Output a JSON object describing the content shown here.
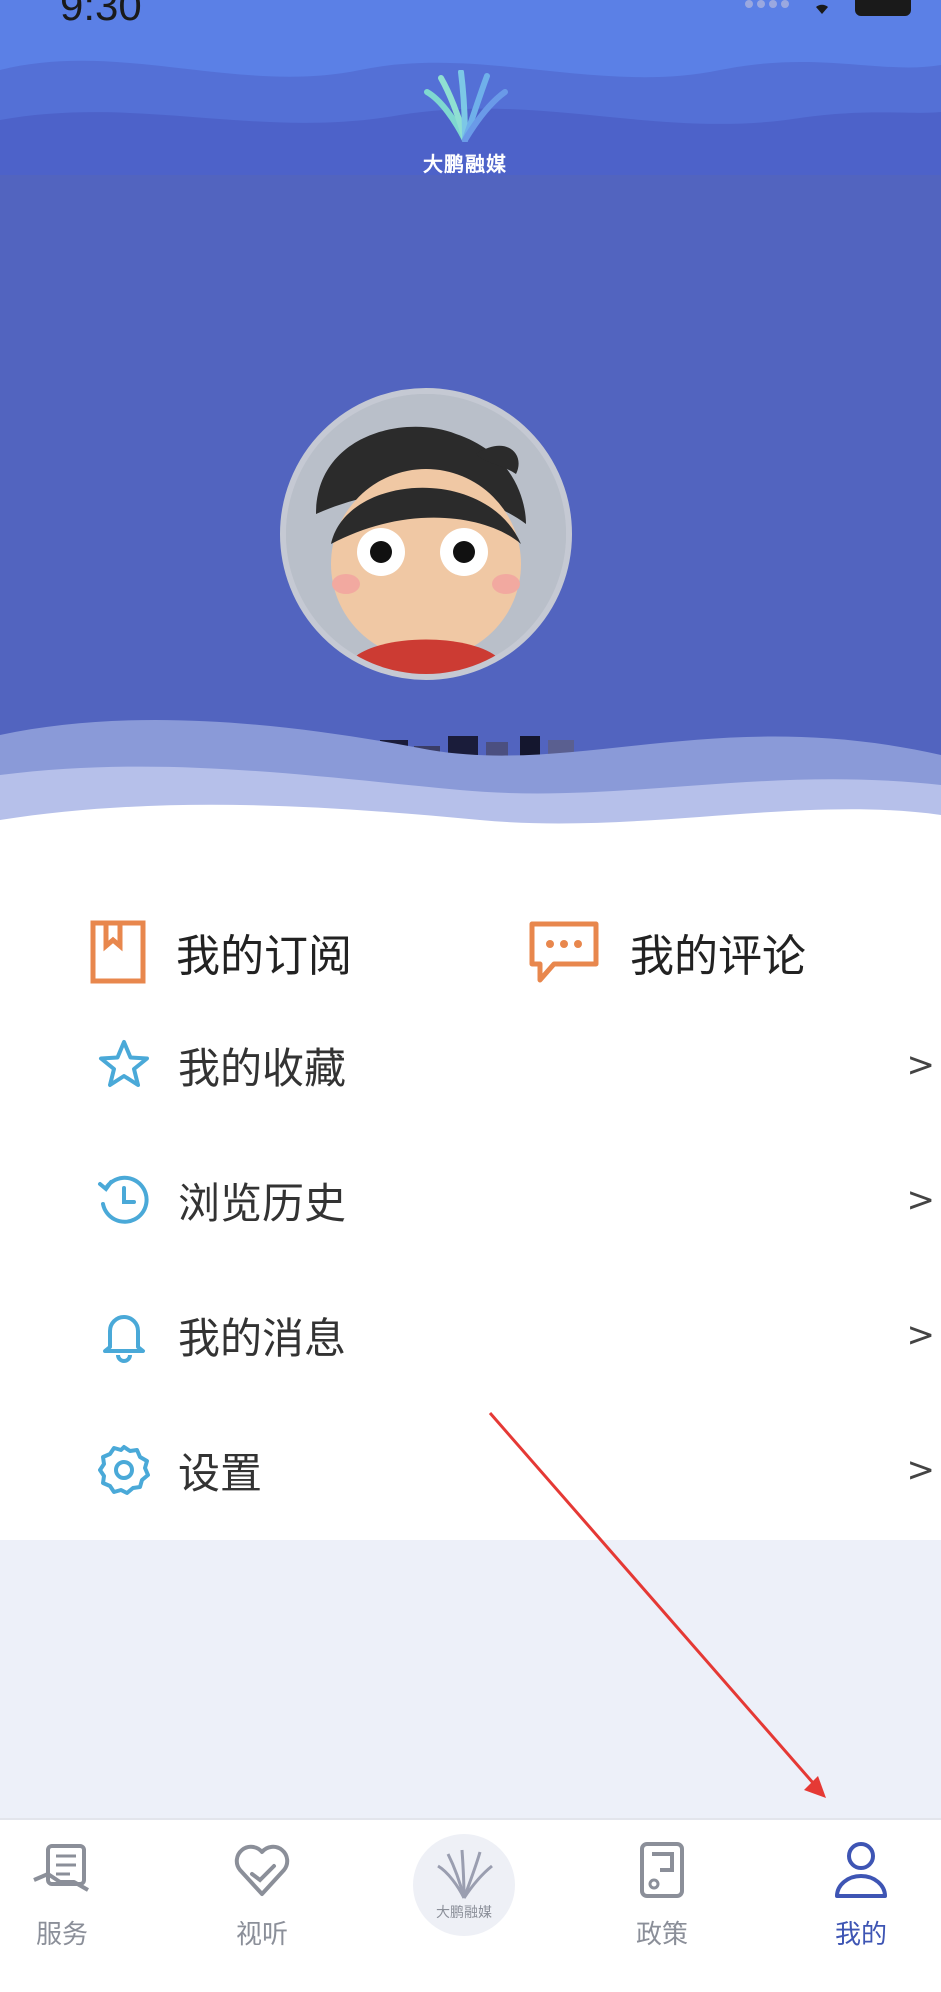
{
  "status_bar": {
    "time": "9:30"
  },
  "header": {
    "logo_text": "大鹏融媒"
  },
  "quick_links": [
    {
      "label": "我的订阅",
      "icon": "bookmark-book-icon"
    },
    {
      "label": "我的评论",
      "icon": "comment-bubble-icon"
    }
  ],
  "menu": [
    {
      "label": "我的收藏",
      "icon": "star-icon",
      "arrow": ">"
    },
    {
      "label": "浏览历史",
      "icon": "history-clock-icon",
      "arrow": ">"
    },
    {
      "label": "我的消息",
      "icon": "bell-icon",
      "arrow": ">"
    },
    {
      "label": "设置",
      "icon": "gear-icon",
      "arrow": ">"
    }
  ],
  "tabbar": {
    "tabs": [
      {
        "label": "服务",
        "icon": "service-icon",
        "active": false
      },
      {
        "label": "视听",
        "icon": "heart-icon",
        "active": false
      },
      {
        "label": "政策",
        "icon": "policy-icon",
        "active": false
      },
      {
        "label": "我的",
        "icon": "user-icon",
        "active": true
      }
    ],
    "center_logo_text": "大鹏融媒"
  },
  "colors": {
    "header_blue": "#5573d8",
    "profile_blue": "#5264bf",
    "accent_orange": "#e8874d",
    "icon_cyan": "#4aa9d8",
    "active_tab": "#3e55b4",
    "annotation_red": "#e53935"
  }
}
